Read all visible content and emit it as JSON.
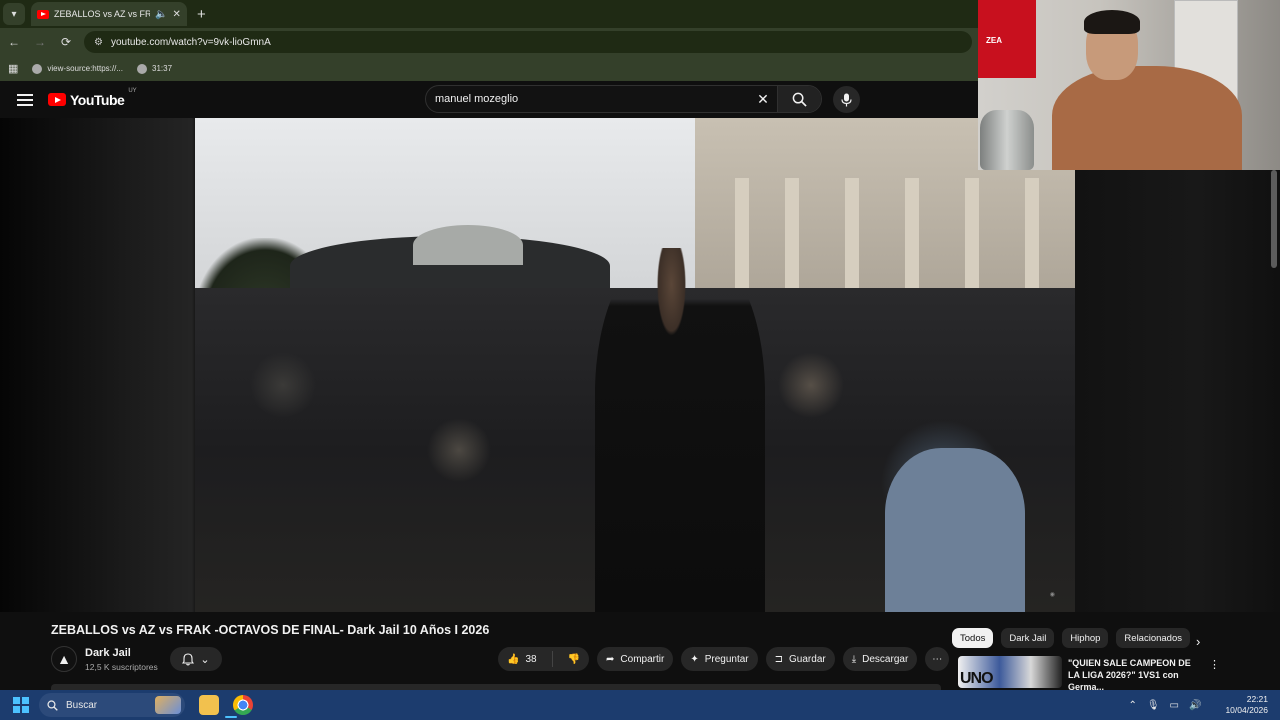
{
  "browser": {
    "tab_title": "ZEBALLOS vs AZ vs FRAK -O",
    "url": "youtube.com/watch?v=9vk-lioGmnA",
    "bookmarks": [
      {
        "label": "view-source:https://..."
      },
      {
        "label": "31:37"
      }
    ]
  },
  "youtube": {
    "logo_text": "YouTube",
    "logo_country": "UY",
    "search_value": "manuel mozeglio",
    "video_title": "ZEBALLOS vs AZ vs FRAK -OCTAVOS DE FINAL- Dark Jail 10 Años I 2026",
    "channel": {
      "name": "Dark Jail",
      "subscribers": "12,5 K suscriptores"
    },
    "actions": {
      "likes": "38",
      "share": "Compartir",
      "ask": "Preguntar",
      "save": "Guardar",
      "download": "Descargar"
    },
    "chips": [
      "Todos",
      "Dark Jail",
      "Hiphop",
      "Relacionados"
    ],
    "recommendation": {
      "title": "\"QUIEN SALE CAMPEON DE LA LIGA 2026?\" 1VS1 con Germa...",
      "thumb_text": "UNO"
    }
  },
  "webcam": {
    "jersey_text": "ZEA"
  },
  "taskbar": {
    "search_label": "Buscar",
    "time": "22:21",
    "date": "10/04/2026"
  },
  "colors": {
    "youtube_red": "#ff0000",
    "page_bg": "#0f0f0f",
    "chrome_green": "#34402a",
    "taskbar_blue": "#1c3c6e"
  }
}
